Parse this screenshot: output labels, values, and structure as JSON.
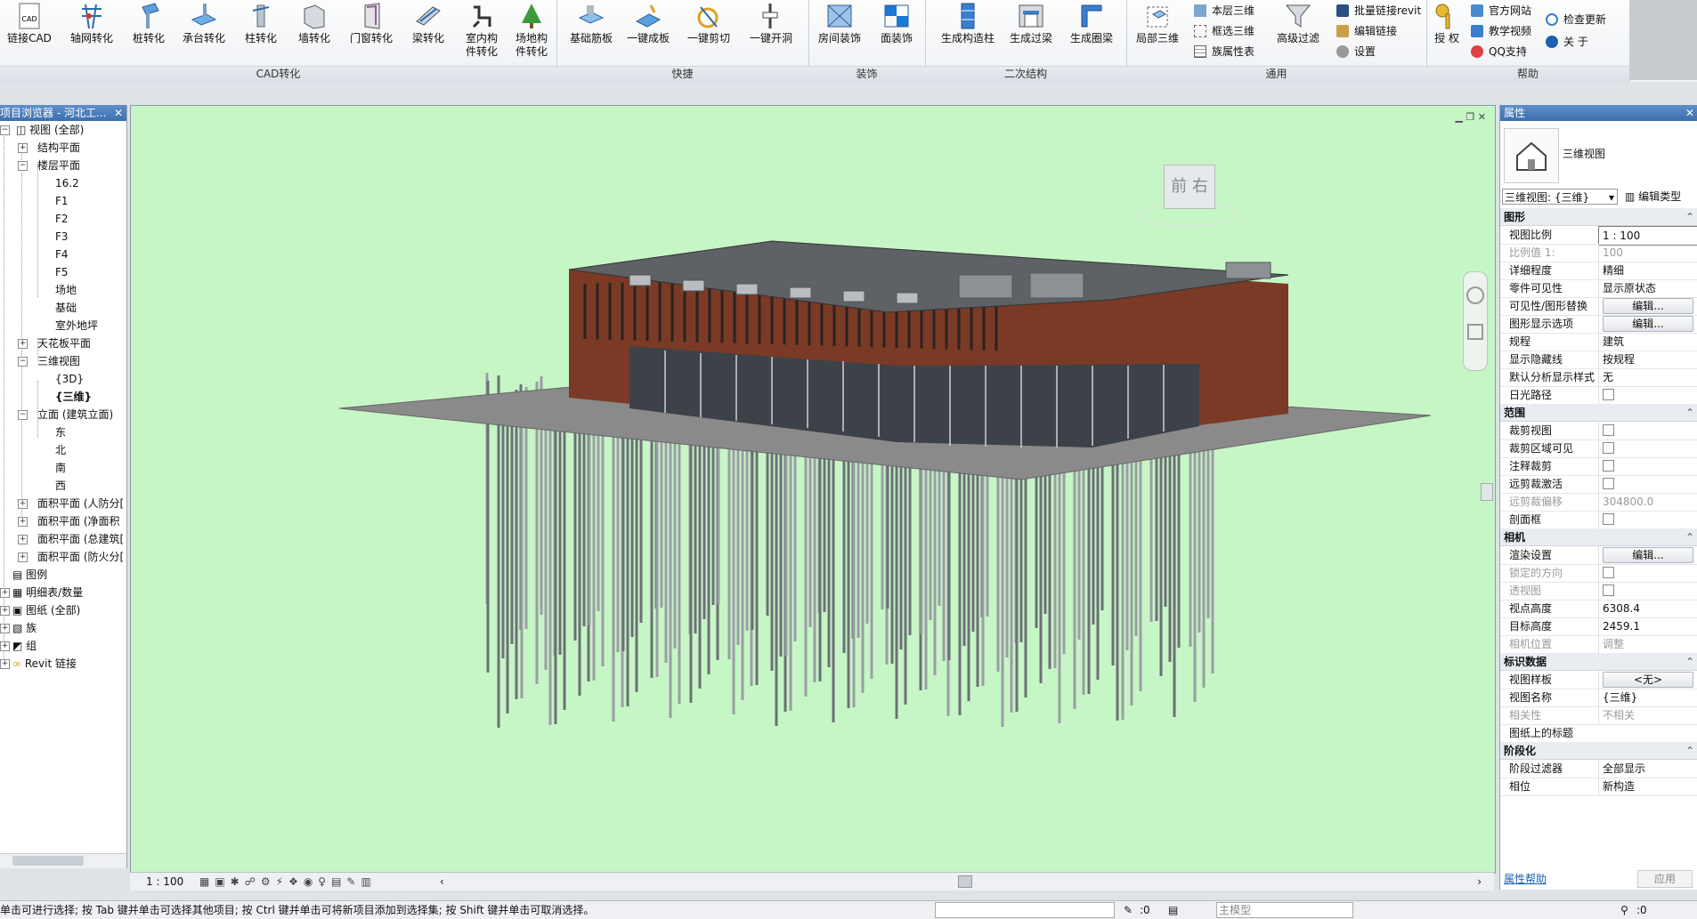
{
  "ribbon": {
    "buttons": {
      "link_cad": "链接CAD",
      "grid_conv": "轴网转化",
      "pile_conv": "桩转化",
      "cap_conv": "承台转化",
      "column_conv": "柱转化",
      "wall_conv": "墙转化",
      "door_win_conv": "门窗转化",
      "beam_conv": "梁转化",
      "indoor_conv_1": "室内构",
      "indoor_conv_2": "件转化",
      "site_conv_1": "场地构",
      "site_conv_2": "件转化",
      "found_slab": "基础筋板",
      "one_key_slab": "一键成板",
      "one_key_cut": "一键剪切",
      "one_key_open": "一键开洞",
      "room_deco": "房间装饰",
      "face_deco": "面装饰",
      "gen_const_col": "生成构造柱",
      "gen_lintel": "生成过梁",
      "gen_ring_beam": "生成圈梁",
      "local_3d": "局部三维",
      "floor_3d": "本层三维",
      "box_3d": "框选三维",
      "family_attr": "族属性表",
      "adv_filter": "高级过滤",
      "batch_link": "批量链接revit",
      "edit_link": "编辑链接",
      "settings": "设置",
      "authorize": "授 权",
      "official_site": "官方网站",
      "teaching_video": "教学视频",
      "qq_support": "QQ支持",
      "check_update": "检查更新",
      "about": "关 于"
    },
    "groups": {
      "cad": "CAD转化",
      "quick": "快捷",
      "deco": "装饰",
      "secondary": "二次结构",
      "general": "通用",
      "help": "帮助"
    }
  },
  "browser": {
    "title": "项目浏览器 - 河北工...",
    "nodes": {
      "views_all": "视图 (全部)",
      "struct_plan": "结构平面",
      "floor_plan": "楼层平面",
      "f162": "16.2",
      "f1": "F1",
      "f2": "F2",
      "f3": "F3",
      "f4": "F4",
      "f5": "F5",
      "site": "场地",
      "found": "基础",
      "outdoor": "室外地坪",
      "ceiling": "天花板平面",
      "views3d": "三维视图",
      "v3d": "{3D}",
      "v3dcn": "{三维}",
      "elev": "立面 (建筑立面)",
      "east": "东",
      "north": "北",
      "south": "南",
      "west": "西",
      "area1": "面积平面 (人防分[",
      "area2": "面积平面 (净面积",
      "area3": "面积平面 (总建筑[",
      "area4": "面积平面 (防火分[",
      "legend": "图例",
      "schedule": "明细表/数量",
      "sheets": "图纸 (全部)",
      "families": "族",
      "groups": "组",
      "links": "Revit 链接"
    }
  },
  "viewcube": {
    "front": "前",
    "right": "右"
  },
  "view_bar": {
    "scale": "1 : 100"
  },
  "props": {
    "title": "属性",
    "type_name": "三维视图",
    "selector": "三维视图: {三维}",
    "edit_type": "编辑类型",
    "sections": {
      "graphics": "图形",
      "extents": "范围",
      "camera": "相机",
      "identity": "标识数据",
      "phasing": "阶段化"
    },
    "rows": {
      "scale_k": "视图比例",
      "scale_v": "1 : 100",
      "scale_val_k": "比例值 1:",
      "scale_val_v": "100",
      "detail_k": "详细程度",
      "detail_v": "精细",
      "parts_k": "零件可见性",
      "parts_v": "显示原状态",
      "vg_k": "可见性/图形替换",
      "edit_btn": "编辑...",
      "gdo_k": "图形显示选项",
      "disc_k": "规程",
      "disc_v": "建筑",
      "hidden_k": "显示隐藏线",
      "hidden_v": "按规程",
      "analysis_k": "默认分析显示样式",
      "analysis_v": "无",
      "sun_k": "日光路径",
      "crop_k": "裁剪视图",
      "crop_vis_k": "裁剪区域可见",
      "anno_k": "注释裁剪",
      "far_k": "远剪裁激活",
      "far_off_k": "远剪裁偏移",
      "far_off_v": "304800.0",
      "section_box_k": "剖面框",
      "render_k": "渲染设置",
      "locked_k": "锁定的方向",
      "persp_k": "透视图",
      "eye_k": "视点高度",
      "eye_v": "6308.4",
      "target_k": "目标高度",
      "target_v": "2459.1",
      "cam_pos_k": "相机位置",
      "cam_pos_v": "调整",
      "template_k": "视图样板",
      "template_v": "<无>",
      "name_k": "视图名称",
      "name_v": "{三维}",
      "dep_k": "相关性",
      "dep_v": "不相关",
      "title_k": "图纸上的标题",
      "phase_filter_k": "阶段过滤器",
      "phase_filter_v": "全部显示",
      "phase_k": "相位",
      "phase_v": "新构造"
    },
    "help_link": "属性帮助",
    "apply": "应用"
  },
  "status": {
    "hint": "单击可进行选择; 按 Tab 键并单击可选择其他项目; 按 Ctrl 键并单击可将新项目添加到选择集; 按 Shift 键并单击可取消选择。",
    "count": ":0",
    "model": "主模型",
    "filter_count": ":0"
  }
}
